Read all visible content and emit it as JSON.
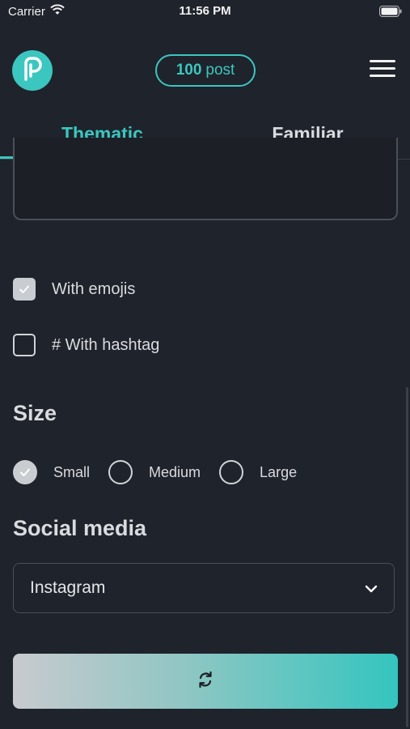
{
  "status_bar": {
    "carrier": "Carrier",
    "time": "11:56 PM"
  },
  "header": {
    "post_count": "100",
    "post_label": "post",
    "logo_icon": "p-logo-icon",
    "menu_icon": "hamburger-menu-icon"
  },
  "tabs": [
    {
      "label": "Thematic",
      "active": true
    },
    {
      "label": "Familiar",
      "active": false
    }
  ],
  "options": {
    "emojis": {
      "label": "With emojis",
      "checked": true
    },
    "hashtag": {
      "label": "# With hashtag",
      "checked": false
    }
  },
  "size": {
    "title": "Size",
    "options": [
      {
        "label": "Small",
        "selected": true
      },
      {
        "label": "Medium",
        "selected": false
      },
      {
        "label": "Large",
        "selected": false
      }
    ]
  },
  "social": {
    "title": "Social media",
    "selected": "Instagram"
  },
  "generate_button": {
    "icon": "refresh-icon"
  },
  "colors": {
    "background": "#1f232b",
    "accent": "#3cc6c0",
    "text": "#d9dbdf"
  }
}
